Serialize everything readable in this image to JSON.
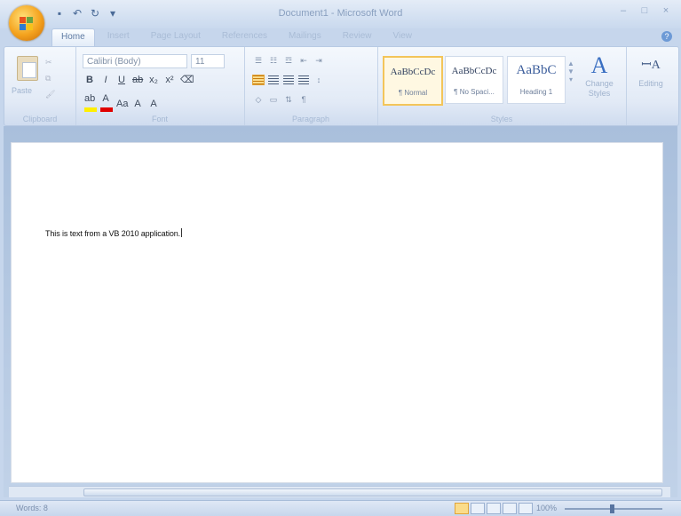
{
  "window": {
    "title": "Document1 - Microsoft Word",
    "controls": [
      "–",
      "□",
      "×"
    ]
  },
  "quick_access": [
    "save-icon",
    "undo-icon",
    "redo-icon",
    "customize-icon"
  ],
  "tabs": [
    {
      "label": "Home",
      "active": true
    },
    {
      "label": "Insert"
    },
    {
      "label": "Page Layout"
    },
    {
      "label": "References"
    },
    {
      "label": "Mailings"
    },
    {
      "label": "Review"
    },
    {
      "label": "View"
    }
  ],
  "ribbon": {
    "clipboard": {
      "label": "Clipboard",
      "paste_label": "Paste"
    },
    "font": {
      "label": "Font",
      "font_name": "Calibri (Body)",
      "font_size": "11"
    },
    "paragraph": {
      "label": "Paragraph"
    },
    "styles": {
      "label": "Styles",
      "items": [
        {
          "sample": "AaBbCcDc",
          "name": "¶ Normal",
          "selected": true
        },
        {
          "sample": "AaBbCcDc",
          "name": "¶ No Spaci..."
        },
        {
          "sample": "AaBbC",
          "name": "Heading 1"
        }
      ],
      "change_styles_label": "Change Styles"
    },
    "editing": {
      "label": "Editing"
    }
  },
  "document": {
    "text": "This is text from a VB 2010 application."
  },
  "status": {
    "page": "Words: 8",
    "zoom": "100%"
  },
  "colors": {
    "accent": "#f4a21d",
    "ribbon_bg": "#e2eaf6",
    "highlight": "#ffef00",
    "font_color": "#e00000"
  }
}
